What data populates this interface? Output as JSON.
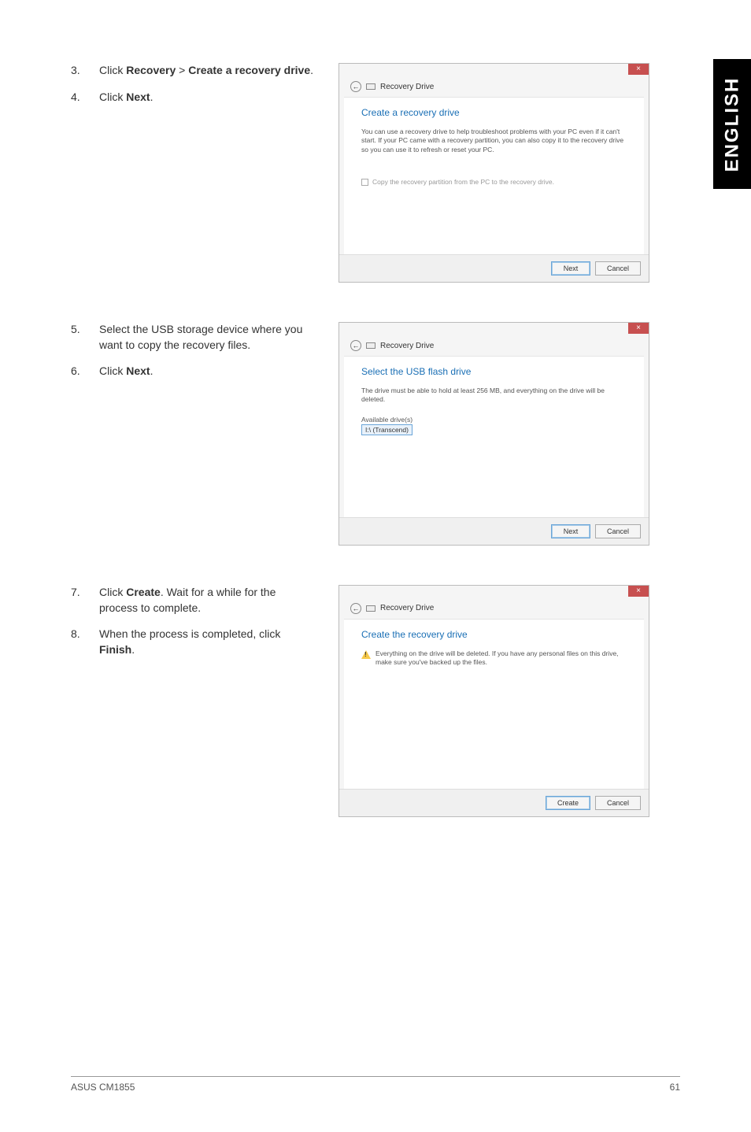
{
  "sideTab": "ENGLISH",
  "block1": {
    "steps": [
      {
        "num": "3.",
        "pre": "Click ",
        "b1": "Recovery",
        "mid": " > ",
        "b2": "Create a recovery drive",
        "post": "."
      },
      {
        "num": "4.",
        "pre": "Click ",
        "b1": "Next",
        "post": "."
      }
    ],
    "dialog": {
      "close": "×",
      "crumb": "Recovery Drive",
      "heading": "Create a recovery drive",
      "desc": "You can use a recovery drive to help troubleshoot problems with your PC even if it can't start. If your PC came with a recovery partition, you can also copy it to the recovery drive so you can use it to refresh or reset your PC.",
      "checkboxLabel": "Copy the recovery partition from the PC to the recovery drive.",
      "btnNext": "Next",
      "btnCancel": "Cancel"
    }
  },
  "block2": {
    "steps": [
      {
        "num": "5.",
        "text": "Select the USB storage device where you want to copy the recovery files."
      },
      {
        "num": "6.",
        "pre": "Click ",
        "b1": "Next",
        "post": "."
      }
    ],
    "dialog": {
      "close": "×",
      "crumb": "Recovery Drive",
      "heading": "Select the USB flash drive",
      "desc": "The drive must be able to hold at least 256 MB, and everything on the drive will be deleted.",
      "availLabel": "Available drive(s)",
      "availValue": "I:\\ (Transcend)",
      "btnNext": "Next",
      "btnCancel": "Cancel"
    }
  },
  "block3": {
    "steps": [
      {
        "num": "7.",
        "pre": "Click ",
        "b1": "Create",
        "post": ". Wait for a while for the process to complete."
      },
      {
        "num": "8.",
        "pre": "When the process is completed, click ",
        "b1": "Finish",
        "post": "."
      }
    ],
    "dialog": {
      "close": "×",
      "crumb": "Recovery Drive",
      "heading": "Create the recovery drive",
      "warn": "Everything on the drive will be deleted. If you have any personal files on this drive, make sure you've backed up the files.",
      "btnCreate": "Create",
      "btnCancel": "Cancel"
    }
  },
  "footer": {
    "left": "ASUS CM1855",
    "right": "61"
  }
}
